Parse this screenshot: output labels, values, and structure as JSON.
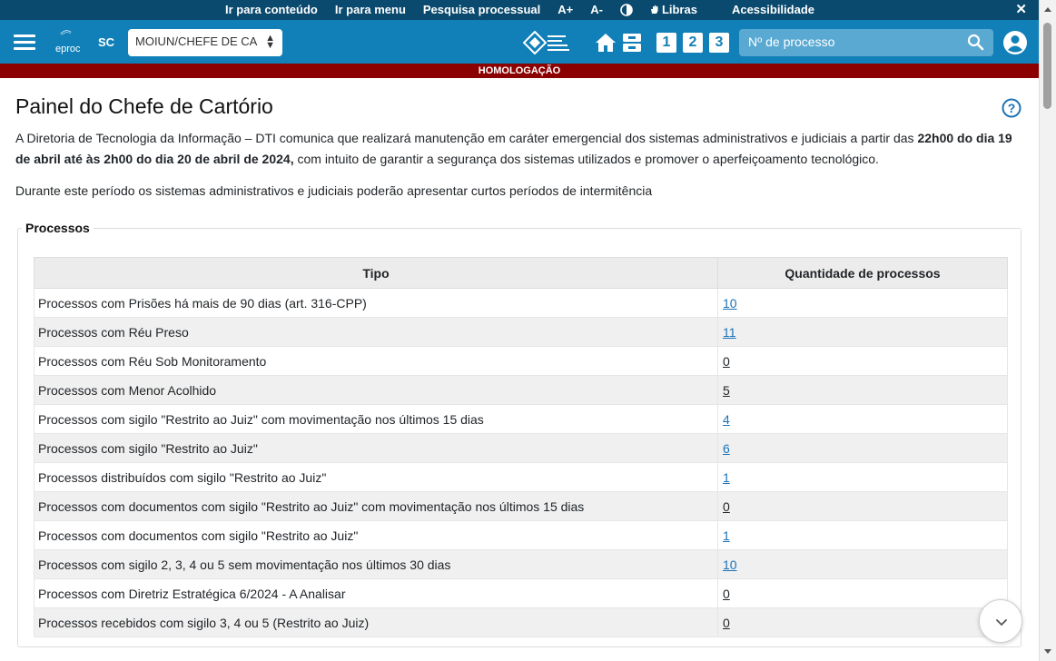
{
  "topbar": {
    "links": [
      {
        "label": "Ir para conteúdo"
      },
      {
        "label": "Ir para menu"
      },
      {
        "label": "Pesquisa processual"
      },
      {
        "label": "A+"
      },
      {
        "label": "A-"
      },
      {
        "label": ""
      },
      {
        "label": "Libras"
      },
      {
        "label": "Acessibilidade"
      }
    ],
    "close_label": "✕"
  },
  "header": {
    "logo_text": "eproc",
    "state": "SC",
    "profile_value": "MOIUN/CHEFE DE CA",
    "search_placeholder": "Nº de processo",
    "num_buttons": [
      "1",
      "2",
      "3"
    ]
  },
  "env_banner": "HOMOLOGAÇÃO",
  "page": {
    "title": "Painel do Chefe de Cartório",
    "notice_pre": "A Diretoria de Tecnologia da Informação – DTI comunica que realizará manutenção em caráter emergencial dos sistemas administrativos e judiciais a partir das ",
    "notice_bold": "22h00 do dia 19 de abril até às 2h00 do dia 20 de abril de 2024,",
    "notice_post": " com intuito de garantir a segurança dos sistemas utilizados e promover o aperfeiçoamento tecnológico.",
    "notice2": "Durante este período os sistemas administrativos e judiciais poderão apresentar curtos períodos de intermitência"
  },
  "processos": {
    "legend": "Processos",
    "columns": [
      "Tipo",
      "Quantidade de processos"
    ],
    "rows": [
      {
        "tipo": "Processos com Prisões há mais de 90 dias (art. 316-CPP)",
        "qtd": "10",
        "style": "link"
      },
      {
        "tipo": "Processos com Réu Preso",
        "qtd": "11",
        "style": "link"
      },
      {
        "tipo": "Processos com Réu Sob Monitoramento",
        "qtd": "0",
        "style": "plain"
      },
      {
        "tipo": "Processos com Menor Acolhido",
        "qtd": "5",
        "style": "plain"
      },
      {
        "tipo": "Processos com sigilo \"Restrito ao Juiz\" com movimentação nos últimos 15 dias",
        "qtd": "4",
        "style": "link"
      },
      {
        "tipo": "Processos com sigilo \"Restrito ao Juiz\"",
        "qtd": "6",
        "style": "link"
      },
      {
        "tipo": "Processos distribuídos com sigilo \"Restrito ao Juiz\"",
        "qtd": "1",
        "style": "link"
      },
      {
        "tipo": "Processos com documentos com sigilo \"Restrito ao Juiz\" com movimentação nos últimos 15 dias",
        "qtd": "0",
        "style": "plain"
      },
      {
        "tipo": "Processos com documentos com sigilo \"Restrito ao Juiz\"",
        "qtd": "1",
        "style": "link"
      },
      {
        "tipo": "Processos com sigilo 2, 3, 4 ou 5 sem movimentação nos últimos 30 dias",
        "qtd": "10",
        "style": "link"
      },
      {
        "tipo": "Processos com Diretriz Estratégica 6/2024 - A Analisar",
        "qtd": "0",
        "style": "plain"
      },
      {
        "tipo": "Processos recebidos com sigilo 3, 4 ou 5 (Restrito ao Juiz)",
        "qtd": "0",
        "style": "plain"
      }
    ]
  },
  "colors": {
    "topbar": "#0a4a6e",
    "header": "#1180b8",
    "banner": "#8b0000",
    "link": "#1a73b8"
  }
}
